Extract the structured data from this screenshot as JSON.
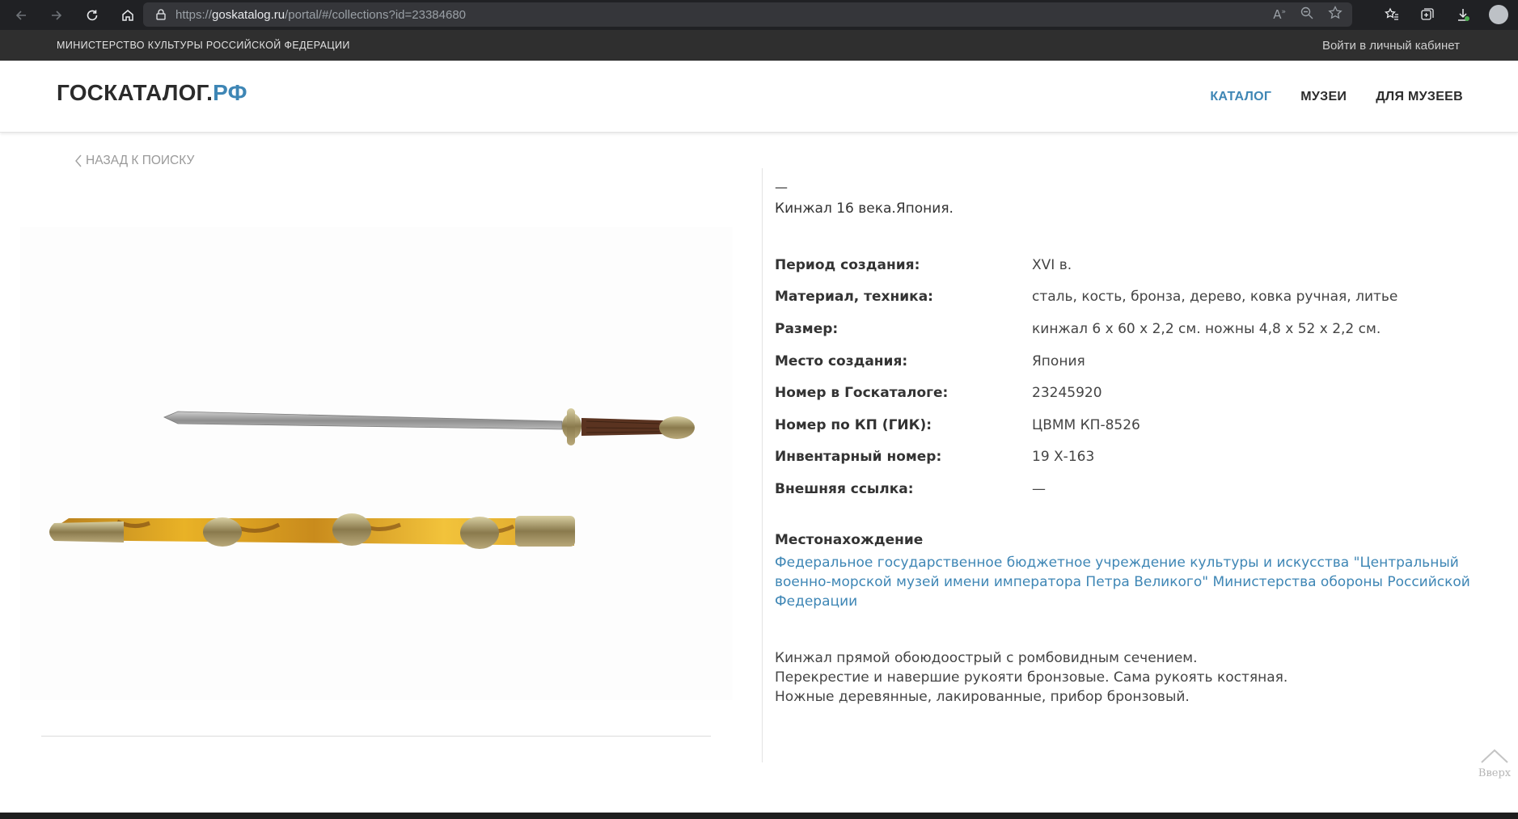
{
  "browser": {
    "url_scheme": "https://",
    "url_host": "goskatalog.ru",
    "url_path": "/portal/#/collections?id=23384680"
  },
  "ministry_bar": {
    "title": "МИНИСТЕРСТВО КУЛЬТУРЫ РОССИЙСКОЙ ФЕДЕРАЦИИ",
    "login": "Войти в личный кабинет"
  },
  "header": {
    "logo_main": "ГОСКАТАЛОГ.",
    "logo_accent": "РФ",
    "nav": [
      {
        "label": "КАТАЛОГ",
        "active": true
      },
      {
        "label": "МУЗЕИ",
        "active": false
      },
      {
        "label": "ДЛЯ МУЗЕЕВ",
        "active": false
      }
    ]
  },
  "back_link": "НАЗАД К ПОИСКУ",
  "item": {
    "dash": "—",
    "title": "Кинжал 16 века.Япония.",
    "properties": [
      {
        "key": "Период создания:",
        "value": "XVI в."
      },
      {
        "key": "Материал, техника:",
        "value": "сталь, кость, бронза, дерево, ковка ручная, литье"
      },
      {
        "key": "Размер:",
        "value": "кинжал 6 х 60 х 2,2 см. ножны 4,8 х 52 х 2,2 см."
      },
      {
        "key": "Место создания:",
        "value": "Япония"
      },
      {
        "key": "Номер в Госкаталоге:",
        "value": "23245920"
      },
      {
        "key": "Номер по КП (ГИК):",
        "value": "ЦВММ КП-8526"
      },
      {
        "key": "Инвентарный номер:",
        "value": "19 Х-163"
      },
      {
        "key": "Внешняя ссылка:",
        "value": "—"
      }
    ],
    "location_heading": "Местонахождение",
    "location_link": "Федеральное государственное бюджетное учреждение культуры и искусства \"Центральный военно-морской музей имени императора Петра Великого\" Министерства обороны Российской Федерации",
    "description": [
      "Кинжал прямой обоюдоострый с ромбовидным сечением.",
      "Перекрестие и навершие рукояти бронзовые. Сама рукоять костяная.",
      "Ножные деревянные, лакированные, прибор бронзовый."
    ]
  },
  "scroll_top_label": "Вверх",
  "colors": {
    "accent": "#3e86b5",
    "ministry_bar": "#2f2f2f",
    "browser_chrome": "#202124"
  }
}
